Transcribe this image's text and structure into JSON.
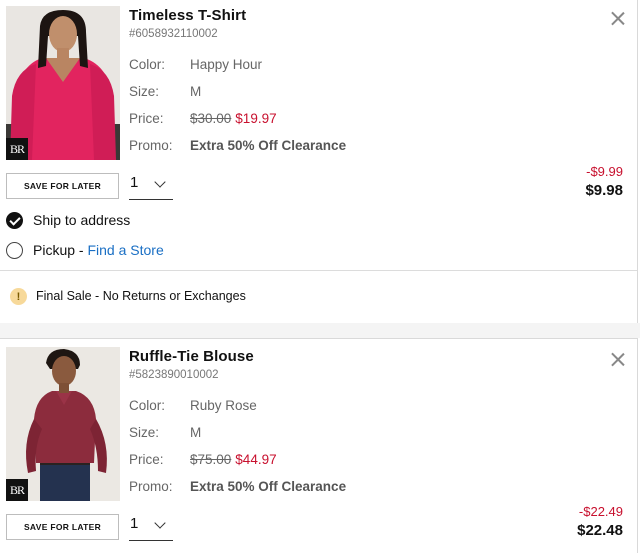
{
  "items": [
    {
      "title": "Timeless T-Shirt",
      "sku": "#6058932110002",
      "attributes": {
        "color_label": "Color:",
        "color_value": "Happy Hour",
        "size_label": "Size:",
        "size_value": "M",
        "price_label": "Price:",
        "price_original": "$30.00",
        "price_sale": "$19.97",
        "promo_label": "Promo:",
        "promo_value": "Extra 50% Off Clearance"
      },
      "save_for_later_label": "SAVE FOR LATER",
      "quantity": "1",
      "discount": "-$9.99",
      "total": "$9.98",
      "brand_mark": "BR",
      "fulfillment": {
        "ship_label": "Ship to address",
        "pickup_label": "Pickup - ",
        "pickup_link": "Find a Store",
        "selected": "ship"
      },
      "notice": {
        "icon": "!",
        "text": "Final Sale - No Returns or Exchanges"
      }
    },
    {
      "title": "Ruffle-Tie Blouse",
      "sku": "#5823890010002",
      "attributes": {
        "color_label": "Color:",
        "color_value": "Ruby Rose",
        "size_label": "Size:",
        "size_value": "M",
        "price_label": "Price:",
        "price_original": "$75.00",
        "price_sale": "$44.97",
        "promo_label": "Promo:",
        "promo_value": "Extra 50% Off Clearance"
      },
      "save_for_later_label": "SAVE FOR LATER",
      "quantity": "1",
      "discount": "-$22.49",
      "total": "$22.48",
      "brand_mark": "BR"
    }
  ],
  "colors": {
    "sale_red": "#c8102e",
    "link_blue": "#1a6fc4",
    "notice_yellow": "#f7d99a"
  },
  "icons": {
    "close": "close-icon",
    "chevron": "chevron-down-icon",
    "notice": "exclamation-icon"
  }
}
